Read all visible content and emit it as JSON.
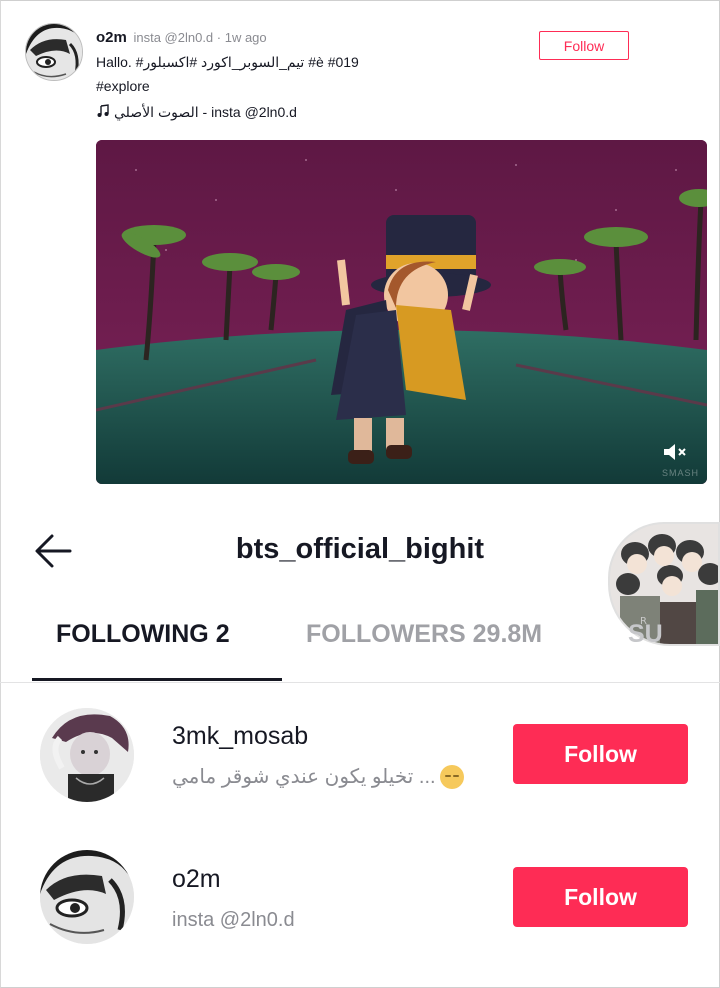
{
  "post": {
    "username": "o2m",
    "meta": "insta @2ln0.d · 1w ago",
    "caption_line1": "Hallo. #تيم_السوبر_اكورد #اكسبلور #è #019",
    "caption_line2": "#explore",
    "sound": "الصوت الأصلي - insta @2ln0.d",
    "follow_label": "Follow",
    "video_watermark": "SMASH",
    "mute_icon": "speaker-muted-icon",
    "note_icon": "music-note-icon"
  },
  "profile": {
    "title": "bts_official_bighit",
    "back_icon": "arrow-left-icon"
  },
  "tabs": {
    "following": "FOLLOWING 2",
    "followers": "FOLLOWERS 29.8M",
    "suggested": "SU"
  },
  "users": [
    {
      "name": "3mk_mosab",
      "bio": "تخيلو يكون عندي شوقر مامي ...",
      "follow_label": "Follow"
    },
    {
      "name": "o2m",
      "bio": "insta @2ln0.d",
      "follow_label": "Follow"
    }
  ],
  "colors": {
    "accent": "#fe2c55",
    "text": "#161823",
    "muted": "#8a8b91"
  }
}
